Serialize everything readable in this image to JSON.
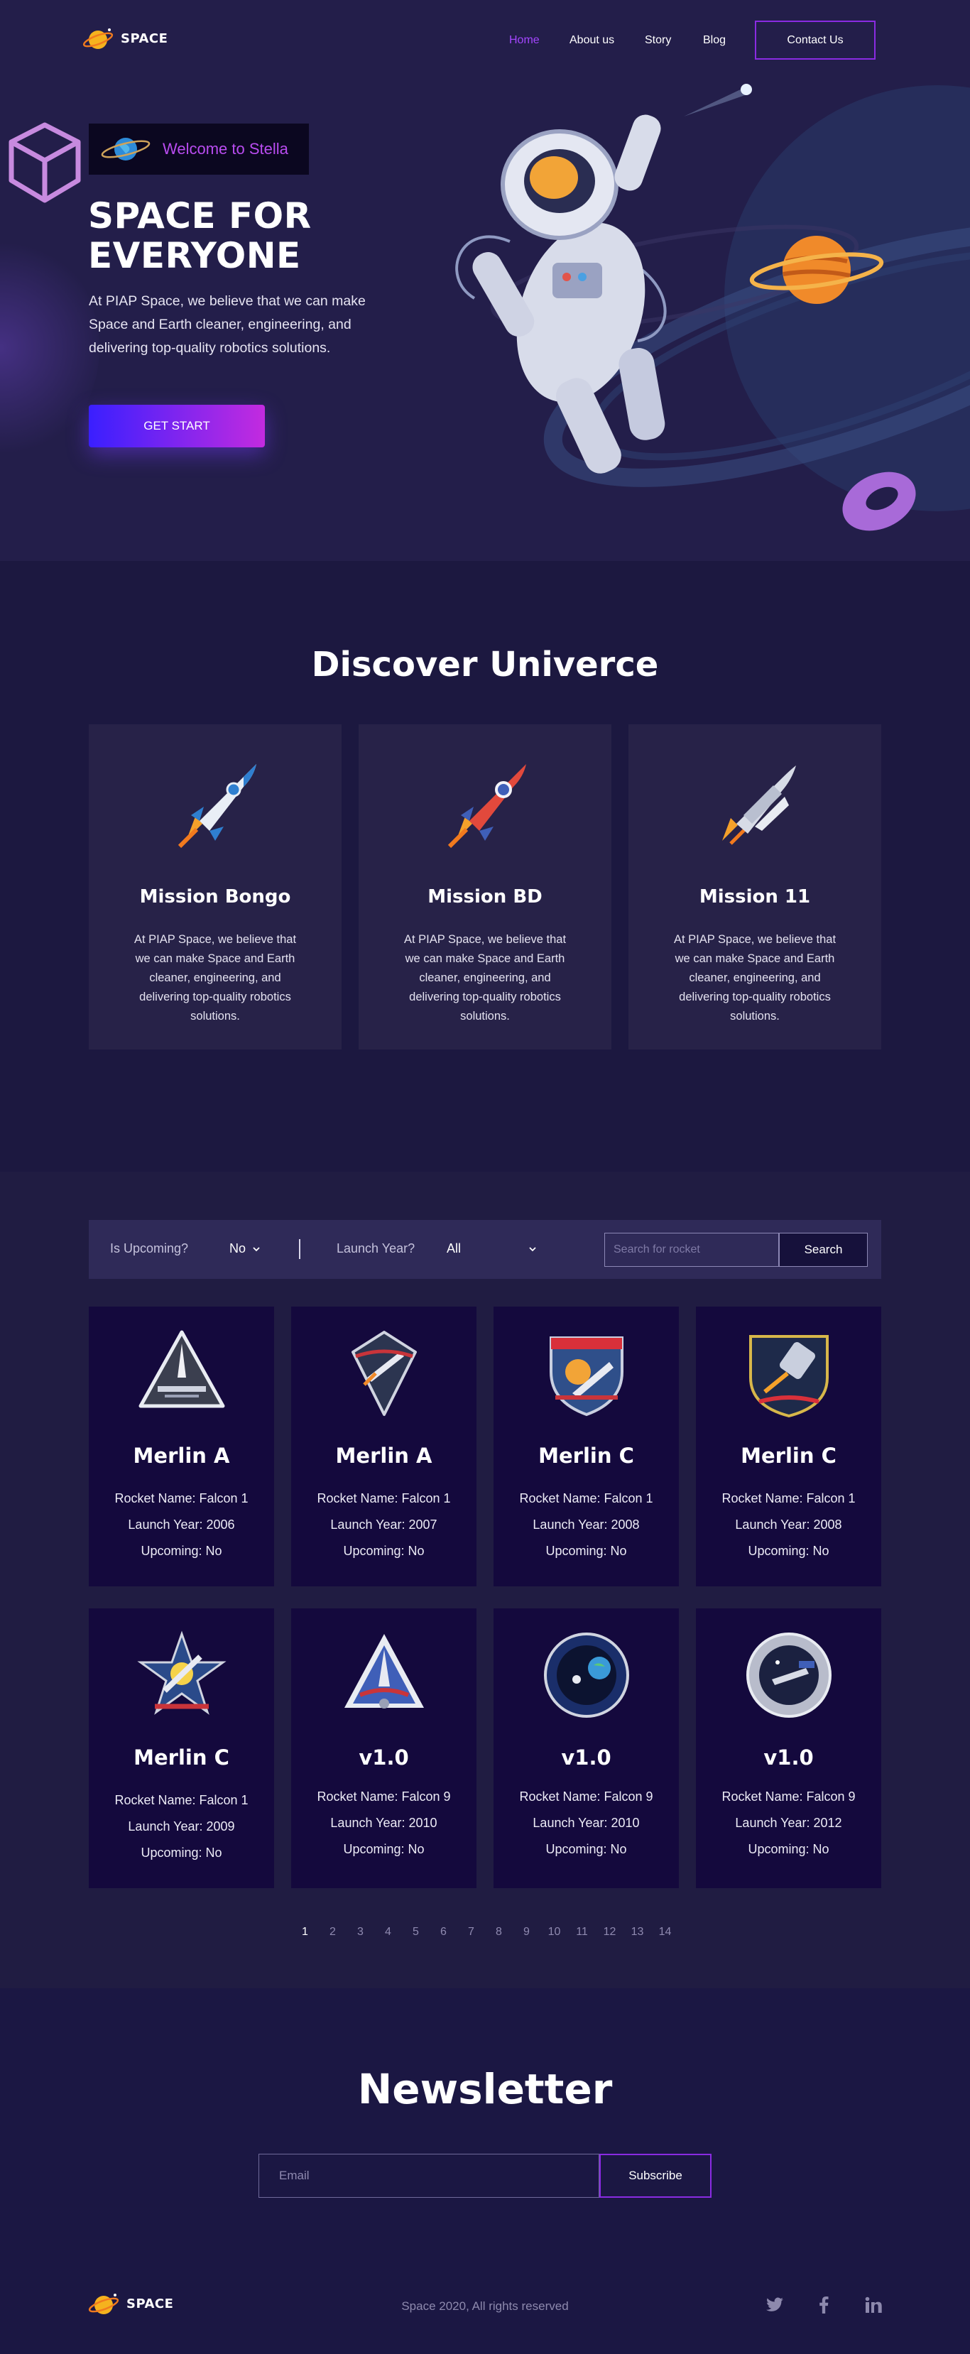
{
  "brand": {
    "name": "SPACE"
  },
  "nav": {
    "links": [
      {
        "label": "Home",
        "active": true
      },
      {
        "label": "About us",
        "active": false
      },
      {
        "label": "Story",
        "active": false
      },
      {
        "label": "Blog",
        "active": false
      }
    ],
    "contact_label": "Contact Us"
  },
  "hero": {
    "welcome": "Welcome to Stella",
    "title_line1": "SPACE FOR",
    "title_line2": "EVERYONE",
    "description": "At PIAP Space, we believe that we can make Space and Earth cleaner, engineering, and delivering top-quality robotics solutions.",
    "cta": "GET START"
  },
  "discover": {
    "title": "Discover Univerce",
    "missions": [
      {
        "title": "Mission Bongo",
        "description": "At PIAP Space, we believe that we can make Space and Earth cleaner, engineering, and delivering top-quality robotics solutions.",
        "icon": "rocket-blue-icon"
      },
      {
        "title": "Mission BD",
        "description": "At PIAP Space, we believe that we can make Space and Earth cleaner, engineering, and delivering top-quality robotics solutions.",
        "icon": "rocket-red-icon"
      },
      {
        "title": "Mission 11",
        "description": "At PIAP Space, we believe that we can make Space and Earth cleaner, engineering, and delivering top-quality robotics solutions.",
        "icon": "space-shuttle-icon"
      }
    ]
  },
  "filters": {
    "upcoming_label": "Is Upcoming?",
    "upcoming_value": "No",
    "year_label": "Launch Year?",
    "year_value": "All",
    "search_placeholder": "Search for rocket",
    "search_button": "Search"
  },
  "rockets": [
    {
      "title": "Merlin A",
      "rocket_name": "Rocket Name: Falcon 1",
      "launch_year": "Launch Year: 2006",
      "upcoming": "Upcoming: No"
    },
    {
      "title": "Merlin A",
      "rocket_name": "Rocket Name: Falcon 1",
      "launch_year": "Launch Year: 2007",
      "upcoming": "Upcoming: No"
    },
    {
      "title": "Merlin C",
      "rocket_name": "Rocket Name: Falcon 1",
      "launch_year": "Launch Year: 2008",
      "upcoming": "Upcoming: No"
    },
    {
      "title": "Merlin C",
      "rocket_name": "Rocket Name: Falcon 1",
      "launch_year": "Launch Year: 2008",
      "upcoming": "Upcoming: No"
    },
    {
      "title": "Merlin C",
      "rocket_name": "Rocket Name: Falcon 1",
      "launch_year": "Launch Year: 2009",
      "upcoming": "Upcoming: No"
    },
    {
      "title": "v1.0",
      "rocket_name": "Rocket Name: Falcon 9",
      "launch_year": "Launch Year: 2010",
      "upcoming": "Upcoming: No"
    },
    {
      "title": "v1.0",
      "rocket_name": "Rocket Name: Falcon 9",
      "launch_year": "Launch Year: 2010",
      "upcoming": "Upcoming: No"
    },
    {
      "title": "v1.0",
      "rocket_name": "Rocket Name: Falcon 9",
      "launch_year": "Launch Year: 2012",
      "upcoming": "Upcoming: No"
    }
  ],
  "pagination": {
    "current": "1",
    "pages": [
      "1",
      "2",
      "3",
      "4",
      "5",
      "6",
      "7",
      "8",
      "9",
      "10",
      "11",
      "12",
      "13",
      "14"
    ]
  },
  "newsletter": {
    "title": "Newsletter",
    "email_placeholder": "Email",
    "subscribe_label": "Subscribe"
  },
  "footer": {
    "copyright": "Space 2020, All rights reserved",
    "social": [
      "twitter-icon",
      "facebook-icon",
      "linkedin-icon"
    ]
  },
  "colors": {
    "accent": "#8a2be2",
    "nav_active": "#a446ff",
    "hero_bg": "#231e4a",
    "card_bg": "#272248",
    "rocket_card_bg": "#14093d"
  }
}
